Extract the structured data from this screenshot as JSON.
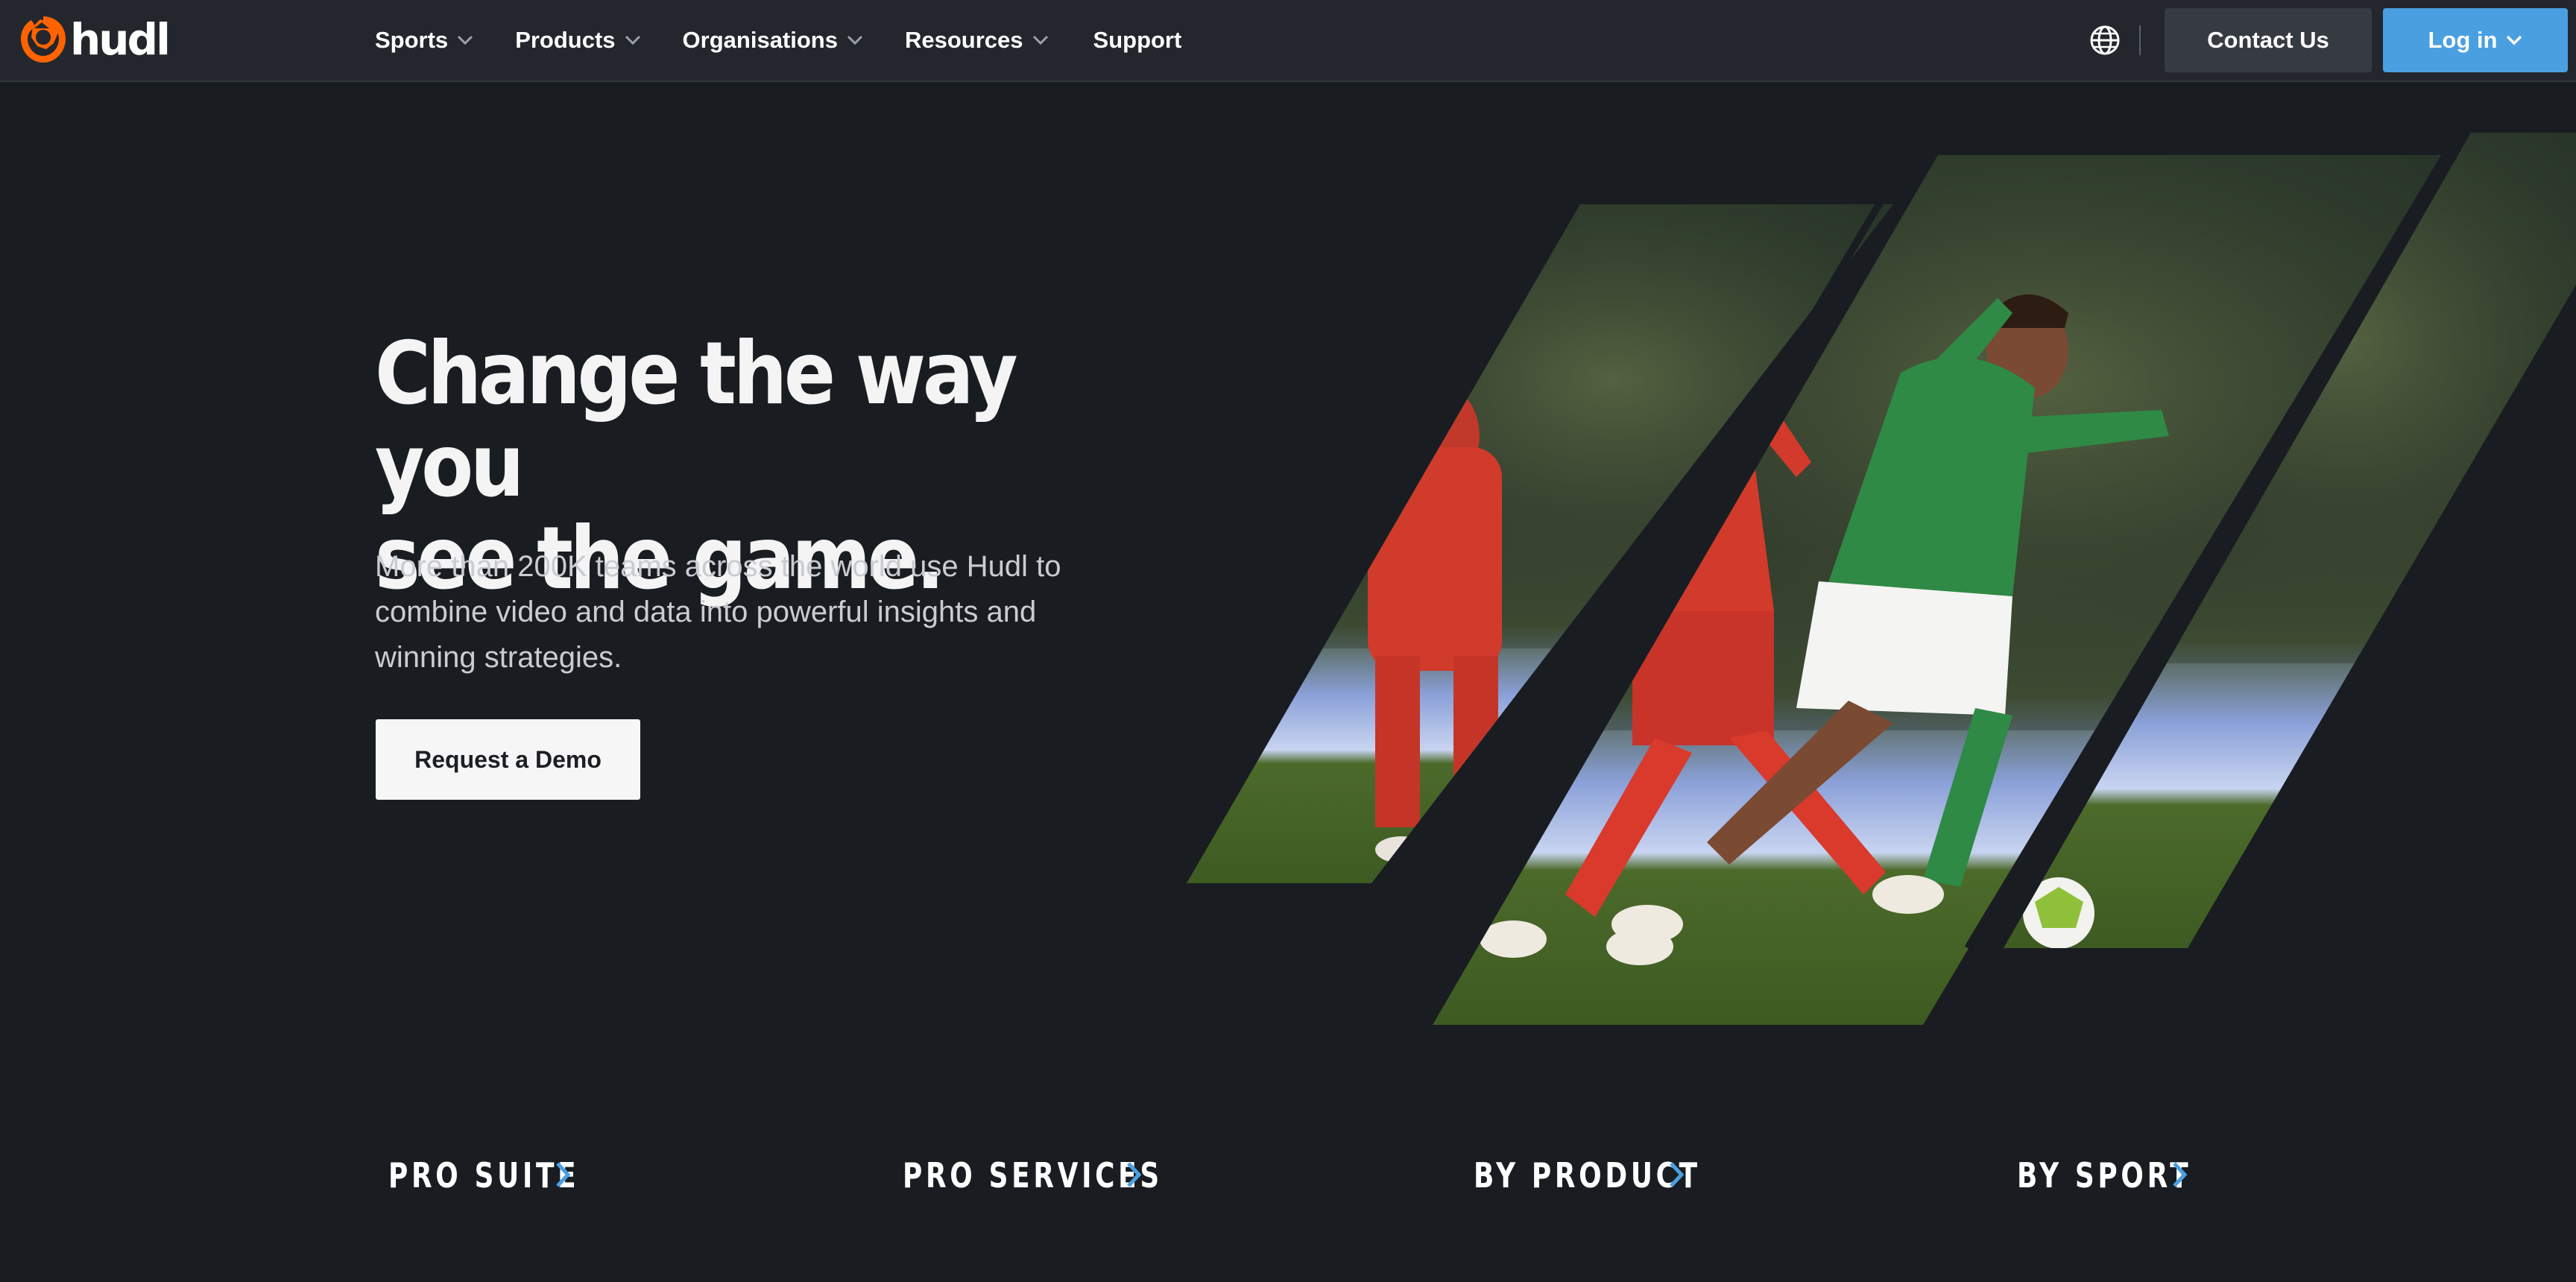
{
  "brand": {
    "name": "hudl",
    "logo_color": "#ff6300"
  },
  "nav": {
    "items": [
      {
        "label": "Sports",
        "has_dropdown": true
      },
      {
        "label": "Products",
        "has_dropdown": true
      },
      {
        "label": "Organisations",
        "has_dropdown": true
      },
      {
        "label": "Resources",
        "has_dropdown": true
      },
      {
        "label": "Support",
        "has_dropdown": false
      }
    ],
    "globe_icon": "globe-icon",
    "contact_label": "Contact Us",
    "login_label": "Log in"
  },
  "hero": {
    "title_line1": "Change the way you",
    "title_line2": "see the game.",
    "subtitle": "More than 200K teams across the world use Hudl to combine video and data into powerful insights and winning strategies.",
    "cta_label": "Request a Demo"
  },
  "categories": [
    {
      "label": "PRO SUITE"
    },
    {
      "label": "PRO SERVICES"
    },
    {
      "label": "BY PRODUCT"
    },
    {
      "label": "BY SPORT"
    }
  ],
  "colors": {
    "background": "#191d21",
    "navbar": "#23272d",
    "accent_blue": "#4a9fe1",
    "contact_button": "#363b42",
    "arrow_blue": "#4a9fe1"
  }
}
